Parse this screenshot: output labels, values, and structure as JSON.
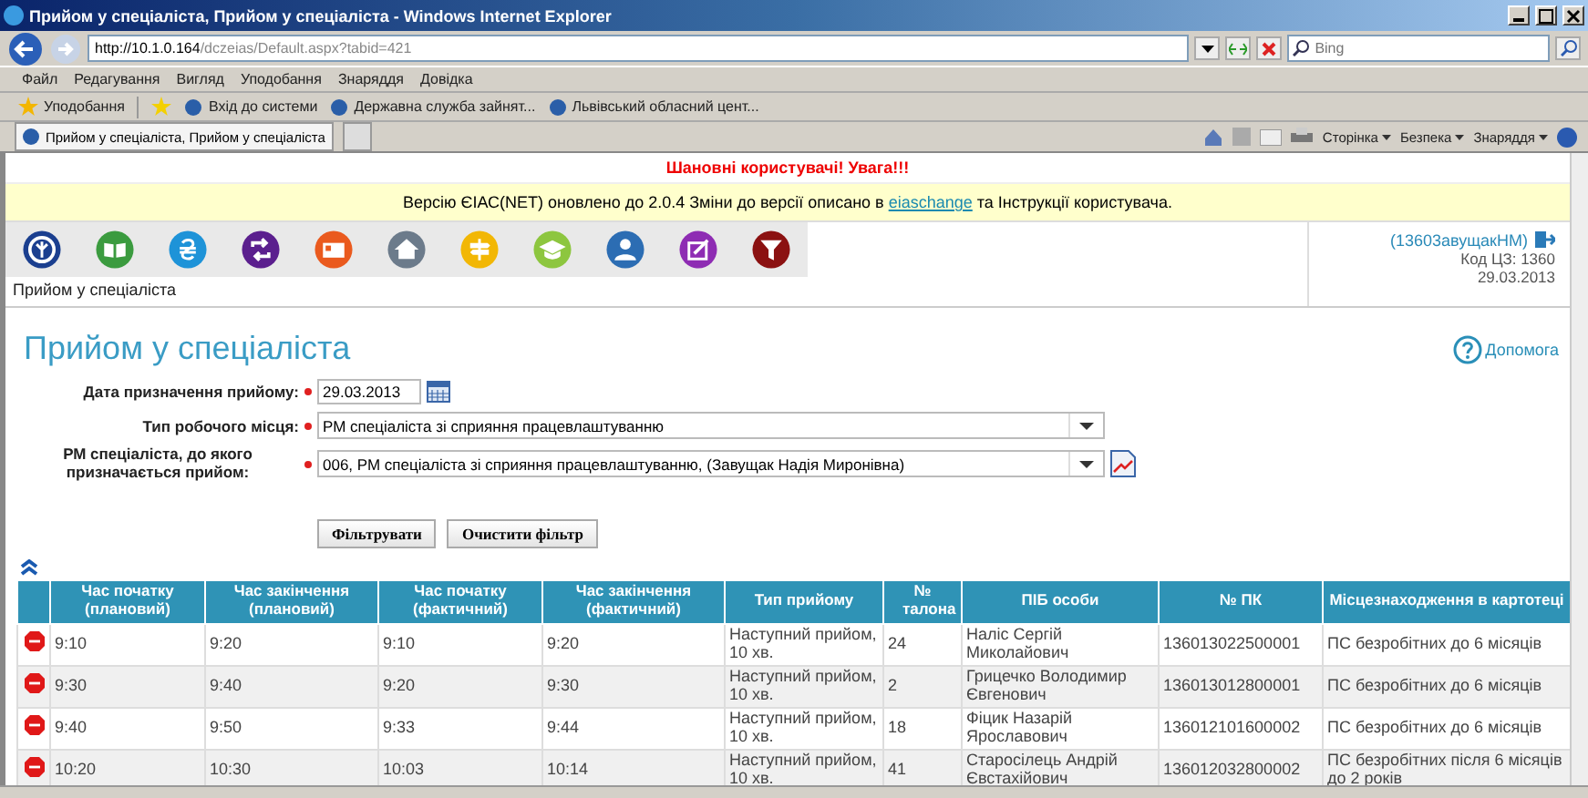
{
  "window": {
    "title": "Прийом у спеціаліста, Прийом у спеціаліста - Windows Internet Explorer"
  },
  "address_bar": {
    "url_host": "http://10.1.0.164",
    "url_path": "/dczeias/Default.aspx?tabid=421"
  },
  "search": {
    "placeholder": "Bing"
  },
  "menu": [
    "Файл",
    "Редагування",
    "Вигляд",
    "Уподобання",
    "Знаряддя",
    "Довідка"
  ],
  "favorites": {
    "label": "Уподобання",
    "links": [
      "Вхід до системи",
      "Державна служба зайнят...",
      "Львівський обласний цент..."
    ]
  },
  "tab": {
    "title": "Прийом у спеціаліста, Прийом у спеціаліста"
  },
  "command_bar": [
    "Сторінка",
    "Безпека",
    "Знаряддя"
  ],
  "notice": {
    "heading": "Шановні користувачі! Увага!!!",
    "text_before": "Версію ЄІАС(NET) оновлено до 2.0.4 Зміни до версії описано в",
    "link": "eiaschange",
    "text_after": "та Інструкції користувача."
  },
  "nav_icons": [
    {
      "kind": "logo",
      "color": "#1b3f8f"
    },
    {
      "kind": "book",
      "color": "#3b9b3f"
    },
    {
      "kind": "hryvnia",
      "color": "#1e93d8"
    },
    {
      "kind": "swap",
      "color": "#5b1f8e"
    },
    {
      "kind": "card",
      "color": "#ea5a1e"
    },
    {
      "kind": "home",
      "color": "#6c7b8b"
    },
    {
      "kind": "signpost",
      "color": "#f2b705"
    },
    {
      "kind": "graduation",
      "color": "#8dc63f"
    },
    {
      "kind": "person",
      "color": "#2c6db3"
    },
    {
      "kind": "edit",
      "color": "#8e2cb3"
    },
    {
      "kind": "filter",
      "color": "#8b1111"
    }
  ],
  "breadcrumb": "Прийом у спеціаліста",
  "user": {
    "name": "(13603авущакНМ)",
    "office_code": "Код ЦЗ: 1360",
    "date": "29.03.2013"
  },
  "page_title": "Прийом у спеціаліста",
  "help": "Допомога",
  "form": {
    "date_label": "Дата призначення прийому:",
    "date_value": "29.03.2013",
    "workplace_type_label": "Тип робочого місця:",
    "workplace_type_value": "РМ спеціаліста зі сприяння працевлаштуванню",
    "specialist_label_line1": "РМ спеціаліста, до якого",
    "specialist_label_line2": "призначається прийом:",
    "specialist_value": "006, РМ спеціаліста зі сприяння працевлаштуванню, (Завущак Надія Миронівна)"
  },
  "buttons": [
    "Фільтрувати",
    "Очистити фільтр"
  ],
  "table": {
    "columns": [
      "Час початку (плановий)",
      "Час закінчення (плановий)",
      "Час початку (фактичний)",
      "Час закінчення (фактичний)",
      "Тип прийому",
      "№ талона",
      "ПІБ особи",
      "№ ПК",
      "Місцезнаходження в картотеці"
    ],
    "rows": [
      [
        "9:10",
        "9:20",
        "9:10",
        "9:20",
        "Наступний прийом, 10 хв.",
        "24",
        "Наліс Сергій Миколайович",
        "136013022500001",
        "ПС безробітних до 6 місяців"
      ],
      [
        "9:30",
        "9:40",
        "9:20",
        "9:30",
        "Наступний прийом, 10 хв.",
        "2",
        "Грицечко Володимир Євгенович",
        "136013012800001",
        "ПС безробітних до 6 місяців"
      ],
      [
        "9:40",
        "9:50",
        "9:33",
        "9:44",
        "Наступний прийом, 10 хв.",
        "18",
        "Фіцик Назарій Ярославович",
        "136012101600002",
        "ПС безробітних до 6 місяців"
      ],
      [
        "10:20",
        "10:30",
        "10:03",
        "10:14",
        "Наступний прийом, 10 хв.",
        "41",
        "Старосілець Андрій Євстахійович",
        "136012032800002",
        "ПС безробітних після 6 місяців до 2 років"
      ]
    ]
  }
}
